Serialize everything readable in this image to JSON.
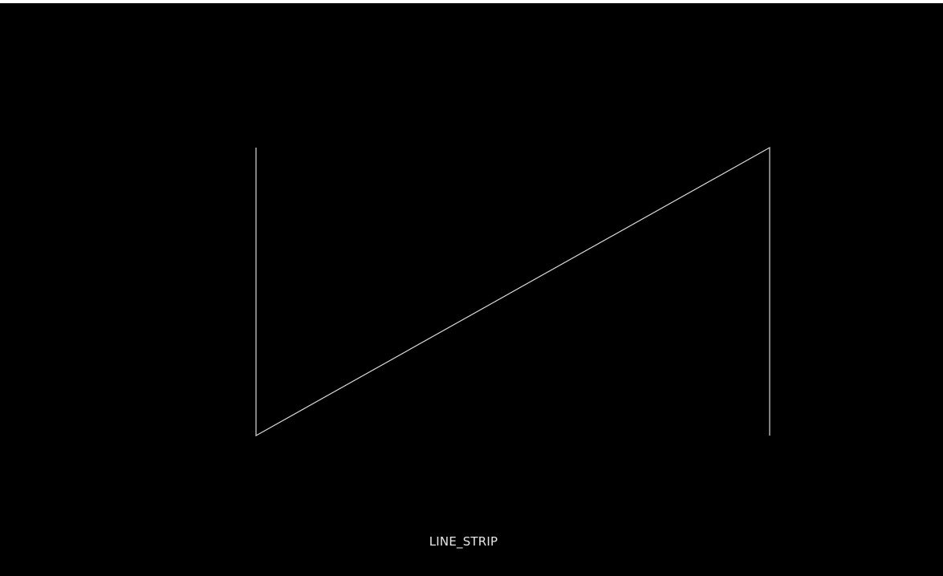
{
  "scene": {
    "primitive_label": "LINE_STRIP",
    "background_color": "#000000",
    "line_color": "#d9d9d9"
  }
}
